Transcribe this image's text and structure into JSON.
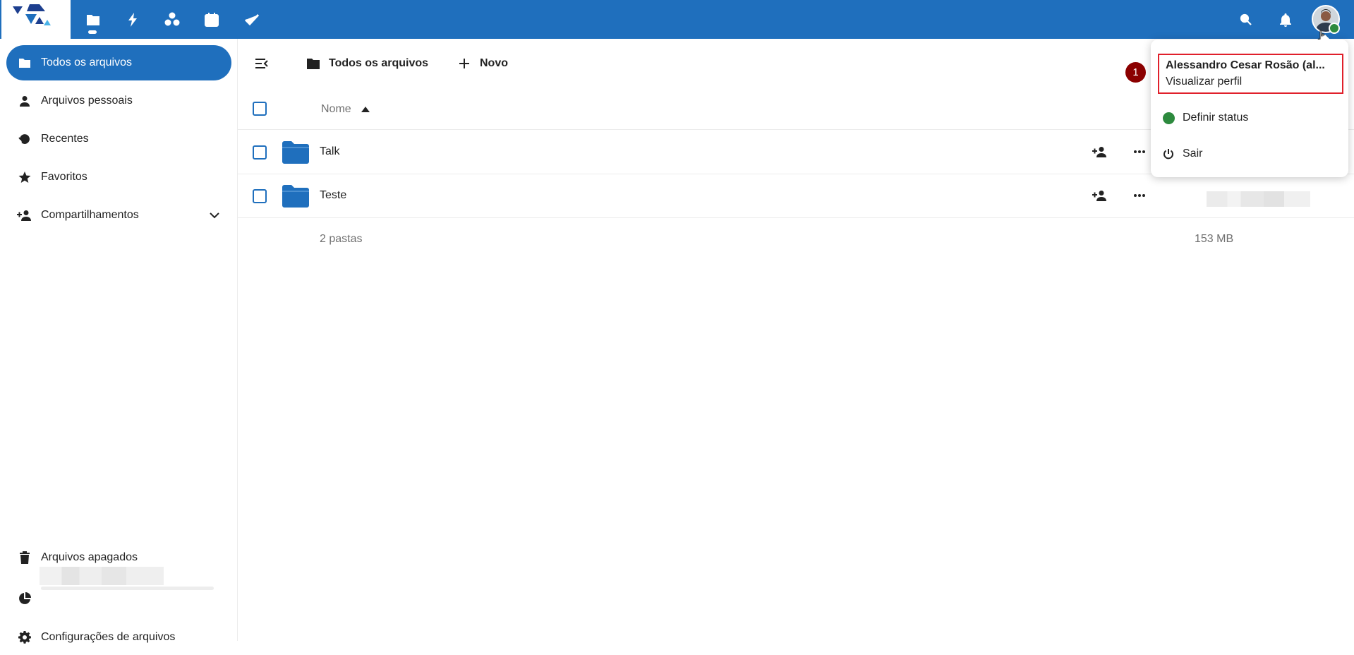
{
  "topbar": {
    "apps": [
      {
        "name": "files",
        "icon": "folder-icon"
      },
      {
        "name": "activity",
        "icon": "lightning-icon"
      },
      {
        "name": "circles",
        "icon": "people-icon"
      },
      {
        "name": "calendar",
        "icon": "calendar-icon"
      },
      {
        "name": "tasks",
        "icon": "checkmark-icon"
      }
    ],
    "active_app": "files",
    "bar_color": "#1f6fbd"
  },
  "sidebar": {
    "items": [
      {
        "label": "Todos os arquivos",
        "icon": "folder-icon",
        "active": true
      },
      {
        "label": "Arquivos pessoais",
        "icon": "person-icon"
      },
      {
        "label": "Recentes",
        "icon": "history-icon"
      },
      {
        "label": "Favoritos",
        "icon": "star-icon"
      },
      {
        "label": "Compartilhamentos",
        "icon": "share-icon",
        "expandable": true
      }
    ],
    "bottom": {
      "trash_label": "Arquivos apagados",
      "settings_label": "Configurações de arquivos"
    }
  },
  "main": {
    "breadcrumb": "Todos os arquivos",
    "new_label": "Novo",
    "column_name": "Nome",
    "rows": [
      {
        "name": "Talk"
      },
      {
        "name": "Teste"
      }
    ],
    "summary": {
      "count": "2 pastas",
      "size": "153 MB"
    }
  },
  "user_menu": {
    "name": "Alessandro Cesar Rosão (al...",
    "profile_link": "Visualizar perfil",
    "status_label": "Definir status",
    "logout_label": "Sair",
    "step_badge": "1",
    "status_color": "#2d8a3e"
  }
}
